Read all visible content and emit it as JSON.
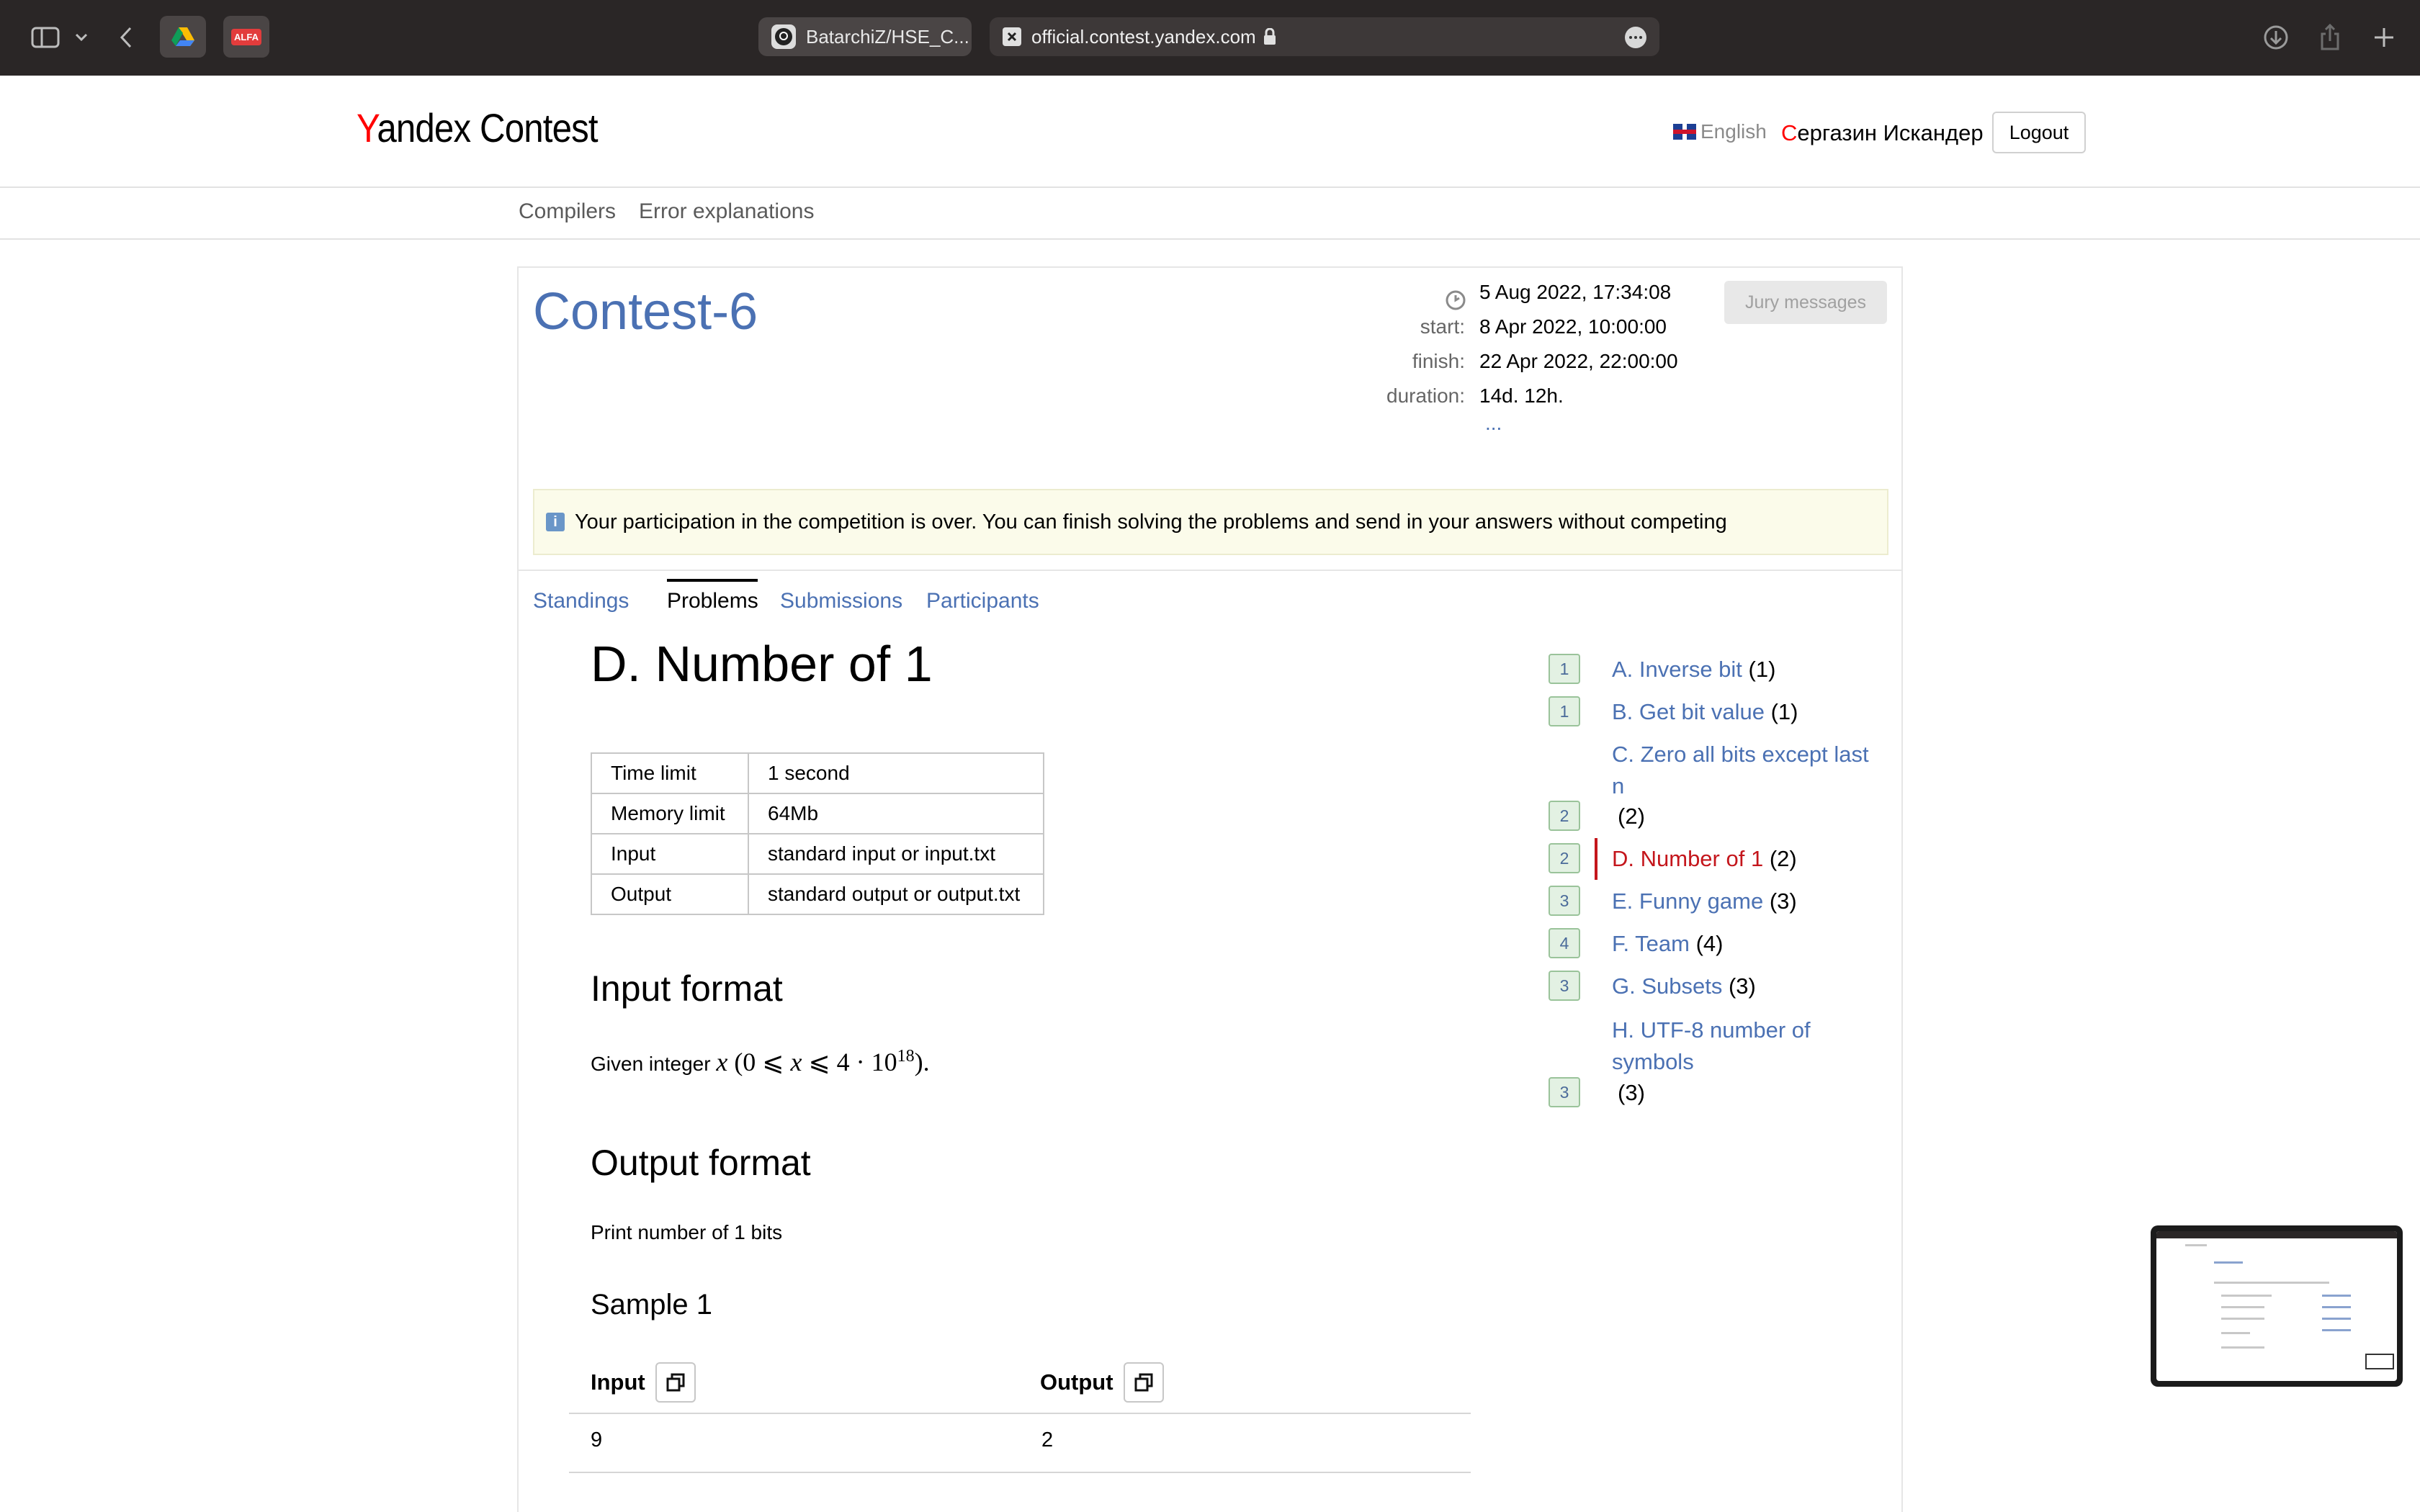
{
  "browser": {
    "tabs": [
      {
        "label": "BatarchiZ/HSE_C...",
        "icon": "github-icon"
      },
      {
        "label": "official.contest.yandex.com",
        "icon": "yandex-favicon-icon"
      }
    ],
    "extensions": [
      "google-drive-icon",
      "alfa-icon"
    ],
    "ext_alfa_label": "ALFA"
  },
  "header": {
    "logo_first": "Y",
    "logo_rest": "andex",
    "logo_second": "Contest",
    "language": "English",
    "user_first": "С",
    "user_rest": "ергазин Искандер",
    "logout_label": "Logout"
  },
  "subnav": {
    "items": [
      "Compilers",
      "Error explanations"
    ]
  },
  "contest": {
    "title": "Contest-6",
    "current_time": "5 Aug 2022, 17:34:08",
    "start_label": "start:",
    "start": "8 Apr 2022, 10:00:00",
    "finish_label": "finish:",
    "finish": "22 Apr 2022, 22:00:00",
    "duration_label": "duration:",
    "duration": "14d. 12h.",
    "more": "...",
    "jury_label": "Jury messages",
    "notice": "Your participation in the competition is over. You can finish solving the problems and send in your answers without competing",
    "tabs": [
      "Standings",
      "Problems",
      "Submissions",
      "Participants"
    ],
    "active_tab": "Problems"
  },
  "problem": {
    "title": "D. Number of 1",
    "limits": [
      {
        "key": "Time limit",
        "value": "1 second"
      },
      {
        "key": "Memory limit",
        "value": "64Mb"
      },
      {
        "key": "Input",
        "value": "standard input or input.txt"
      },
      {
        "key": "Output",
        "value": "standard output or output.txt"
      }
    ],
    "input_format_heading": "Input format",
    "input_text": "Given integer",
    "output_format_heading": "Output format",
    "output_text": "Print number of 1 bits",
    "sample_heading": "Sample 1",
    "sample_input_label": "Input",
    "sample_output_label": "Output",
    "sample_input": "9",
    "sample_output": "2"
  },
  "problem_list": [
    {
      "badge": "1",
      "name": "A. Inverse bit",
      "count": "(1)"
    },
    {
      "badge": "1",
      "name": "B. Get bit value",
      "count": "(1)"
    },
    {
      "badge": "2",
      "name_line1": "C. Zero all bits except last",
      "name_line2": "n",
      "count": "(2)"
    },
    {
      "badge": "2",
      "name": "D. Number of 1",
      "count": "(2)",
      "current": true
    },
    {
      "badge": "3",
      "name": "E. Funny game",
      "count": "(3)"
    },
    {
      "badge": "4",
      "name": "F. Team",
      "count": "(4)"
    },
    {
      "badge": "3",
      "name": "G. Subsets",
      "count": "(3)"
    },
    {
      "badge": "3",
      "name_line1": "H. UTF-8 number of",
      "name_line2": "symbols",
      "count": "(3)"
    }
  ],
  "colors": {
    "link": "#4b71b3",
    "current": "#c4161c",
    "badge_bg": "#e3f1e3",
    "chrome_bg": "#2a2626"
  }
}
